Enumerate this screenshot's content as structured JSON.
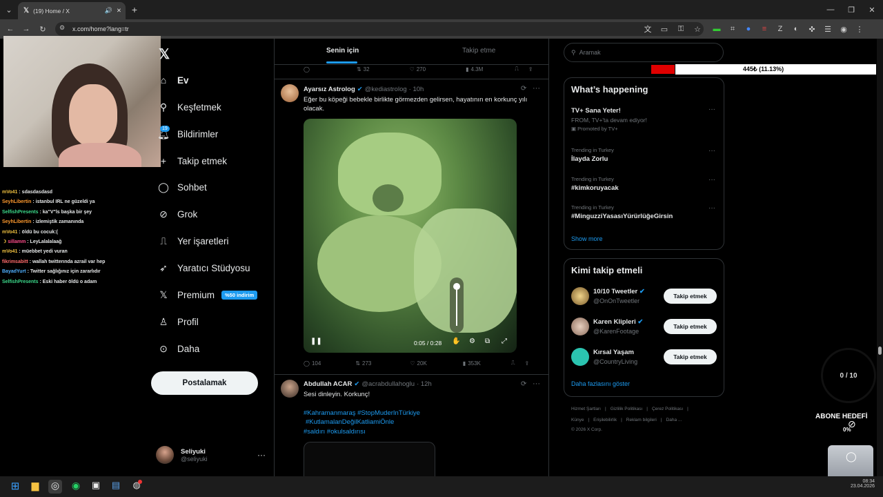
{
  "browser": {
    "tab_title": "(19) Home / X",
    "url": "x.com/home?lang=tr"
  },
  "chat": [
    {
      "user": "mVo41",
      "msg": "sdasdasdasd",
      "color": "#f0c040"
    },
    {
      "user": "SeyhLibertin",
      "msg": "istanbul IRL ne güzeldi ya",
      "color": "#ff9a2e"
    },
    {
      "user": "SelfishPresents",
      "msg": "ka\"V\"ls başka bir şey",
      "color": "#3cdc8c"
    },
    {
      "user": "SeyhLibertin",
      "msg": "izlemiştik zamanında",
      "color": "#ff9a2e"
    },
    {
      "user": "mVo41",
      "msg": "öldü bu cocuk:(",
      "color": "#f0c040"
    },
    {
      "user": "sillamm",
      "msg": "LeyLalalalaağ",
      "color": "#ff4d8b"
    },
    {
      "user": "mVo41",
      "msg": "müebbet yedi vuran",
      "color": "#f0c040"
    },
    {
      "user": "fikrimsabitt",
      "msg": "wallah twitterında azrail var hep",
      "color": "#ff6b6b"
    },
    {
      "user": "BayadYurt",
      "msg": "Twitter sağlığınız için zararlıdır",
      "color": "#4fb0ff"
    },
    {
      "user": "SelfishPresents",
      "msg": "Eski haber öldü o adam",
      "color": "#3cdc8c"
    }
  ],
  "nav": {
    "notif_badge": "19",
    "items": [
      {
        "label": "Ev"
      },
      {
        "label": "Keşfetmek"
      },
      {
        "label": "Bildirimler"
      },
      {
        "label": "Takip etmek"
      },
      {
        "label": "Sohbet"
      },
      {
        "label": "Grok"
      },
      {
        "label": "Yer işaretleri"
      },
      {
        "label": "Yaratıcı Stüdyosu"
      },
      {
        "label": "Premium"
      },
      {
        "label": "Profil"
      },
      {
        "label": "Daha"
      }
    ],
    "premium_badge": "%50 indirim",
    "post_button": "Postalamak"
  },
  "account": {
    "name": "Seliyuki",
    "handle": "@seliyuki"
  },
  "feed_tabs": [
    "Senin için",
    "Takip etme"
  ],
  "prev_tweet_actions": {
    "retweets": "32",
    "likes": "270",
    "views": "4.3M"
  },
  "tweets": [
    {
      "name": "Ayarsız Astrolog",
      "handle": "@kediastrolog",
      "time": "· 10h",
      "text": "Eğer bu köpeği bebekle birlikte görmezden gelirsen, hayatının en korkunç yılı olacak.",
      "video_time": "0:05 / 0:28",
      "replies": "104",
      "retweets": "273",
      "likes": "20K",
      "views": "353K"
    },
    {
      "name": "Abdullah ACAR",
      "handle": "@acrabdullahoglu",
      "time": "· 12h",
      "text": "Sesi dinleyin. Korkunç!",
      "hashtags1": "#Kahramanmaraş #StopMuderInTürkiye",
      "hashtags2": "#KutlamalanDeğilKatliamiÖnle",
      "hashtags3": "#saldırı #okulsaldırısı"
    }
  ],
  "search": {
    "placeholder": "Aramak"
  },
  "overlay_bar": {
    "text": "445₺ (11.13%)",
    "progress_percent": 11.13,
    "fill_color": "#e00000"
  },
  "happening": {
    "title": "What’s happening",
    "items": [
      {
        "title": "TV+ Sana Yeter!",
        "sub": "FROM, TV+'ta devam ediyor!",
        "meta": "Promoted by TV+"
      },
      {
        "context": "Trending in Turkey",
        "title": "İlayda Zorlu"
      },
      {
        "context": "Trending in Turkey",
        "title": "#kimkoruyacak"
      },
      {
        "context": "Trending in Turkey",
        "title": "#MinguzziYasasıYürürlüğeGirsin"
      }
    ],
    "show_more": "Show more"
  },
  "who_to_follow": {
    "title": "Kimi takip etmeli",
    "accounts": [
      {
        "name": "10/10 Tweetler",
        "handle": "@OnOnTweetler",
        "button": "Takip etmek"
      },
      {
        "name": "Karen Klipleri",
        "handle": "@KarenFootage",
        "button": "Takip etmek"
      },
      {
        "name": "Kırsal Yaşam",
        "handle": "@CountryLiving",
        "button": "Takip etmek"
      }
    ],
    "more": "Daha fazlasını göster"
  },
  "footer": {
    "links1": [
      "Hizmet Şartları",
      "Gizlilik Politikası",
      "Çerez Politikası"
    ],
    "links2": [
      "Künye",
      "Erişilebilirlik",
      "Reklam bilgileri",
      "Daha ..."
    ],
    "copyright": "© 2026 X Corp."
  },
  "stream_overlay": {
    "counter": "0 / 10",
    "sub_goal": "ABONE HEDEFİ",
    "sub_pct": "0%"
  },
  "clock": {
    "time": "08:34",
    "date": "23.04.2026"
  }
}
